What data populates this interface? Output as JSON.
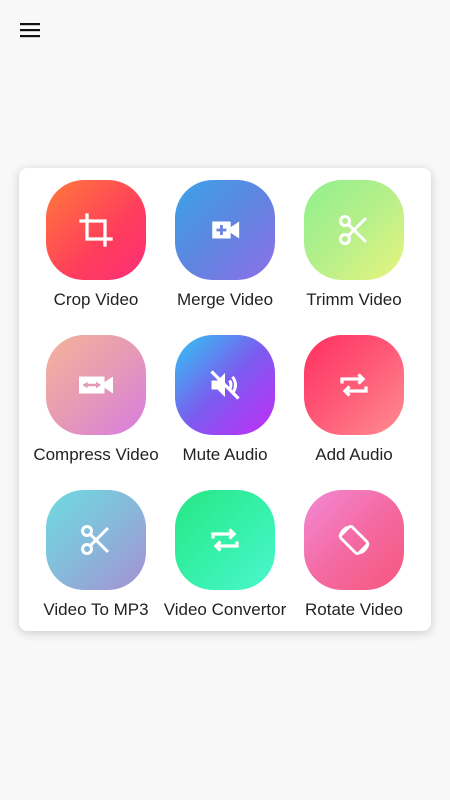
{
  "header": {
    "menu_icon": "hamburger-menu-icon"
  },
  "tools": [
    {
      "label": "Crop Video",
      "icon": "crop-icon"
    },
    {
      "label": "Merge Video",
      "icon": "video-add-icon"
    },
    {
      "label": "Trimm Video",
      "icon": "scissors-icon"
    },
    {
      "label": "Compress Video",
      "icon": "video-resize-icon"
    },
    {
      "label": "Mute Audio",
      "icon": "volume-off-icon"
    },
    {
      "label": "Add Audio",
      "icon": "repeat-icon"
    },
    {
      "label": "Video To MP3",
      "icon": "scissors-icon"
    },
    {
      "label": "Video Convertor",
      "icon": "repeat-icon"
    },
    {
      "label": "Rotate Video",
      "icon": "screen-rotation-icon"
    }
  ],
  "colors": {
    "background": "#f8f8f8",
    "card": "#ffffff",
    "label": "#222222",
    "icon": "#ffffff"
  }
}
